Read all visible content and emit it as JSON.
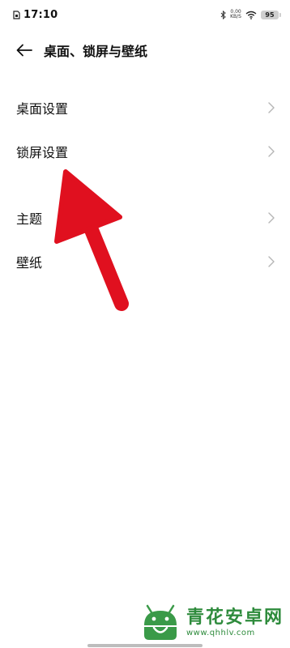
{
  "status_bar": {
    "time": "17:10",
    "net_speed_value": "0.00",
    "net_speed_unit": "KB/S",
    "battery_level": "95",
    "icons": [
      "sim-card-icon",
      "bluetooth-icon",
      "wifi-icon",
      "battery-icon"
    ]
  },
  "header": {
    "title": "桌面、锁屏与壁纸",
    "back_icon": "back-arrow-icon"
  },
  "settings": {
    "items": [
      {
        "label": "桌面设置"
      },
      {
        "label": "锁屏设置"
      },
      {
        "label": "主题"
      },
      {
        "label": "壁纸"
      }
    ]
  },
  "annotation": {
    "arrow_color": "#e0101f"
  },
  "watermark": {
    "name": "青花安卓网",
    "url": "www.qhhlv.com"
  },
  "colors": {
    "background": "#ffffff",
    "text": "#111111",
    "chevron": "#b5b5b5",
    "watermark": "#2e8b3c"
  }
}
